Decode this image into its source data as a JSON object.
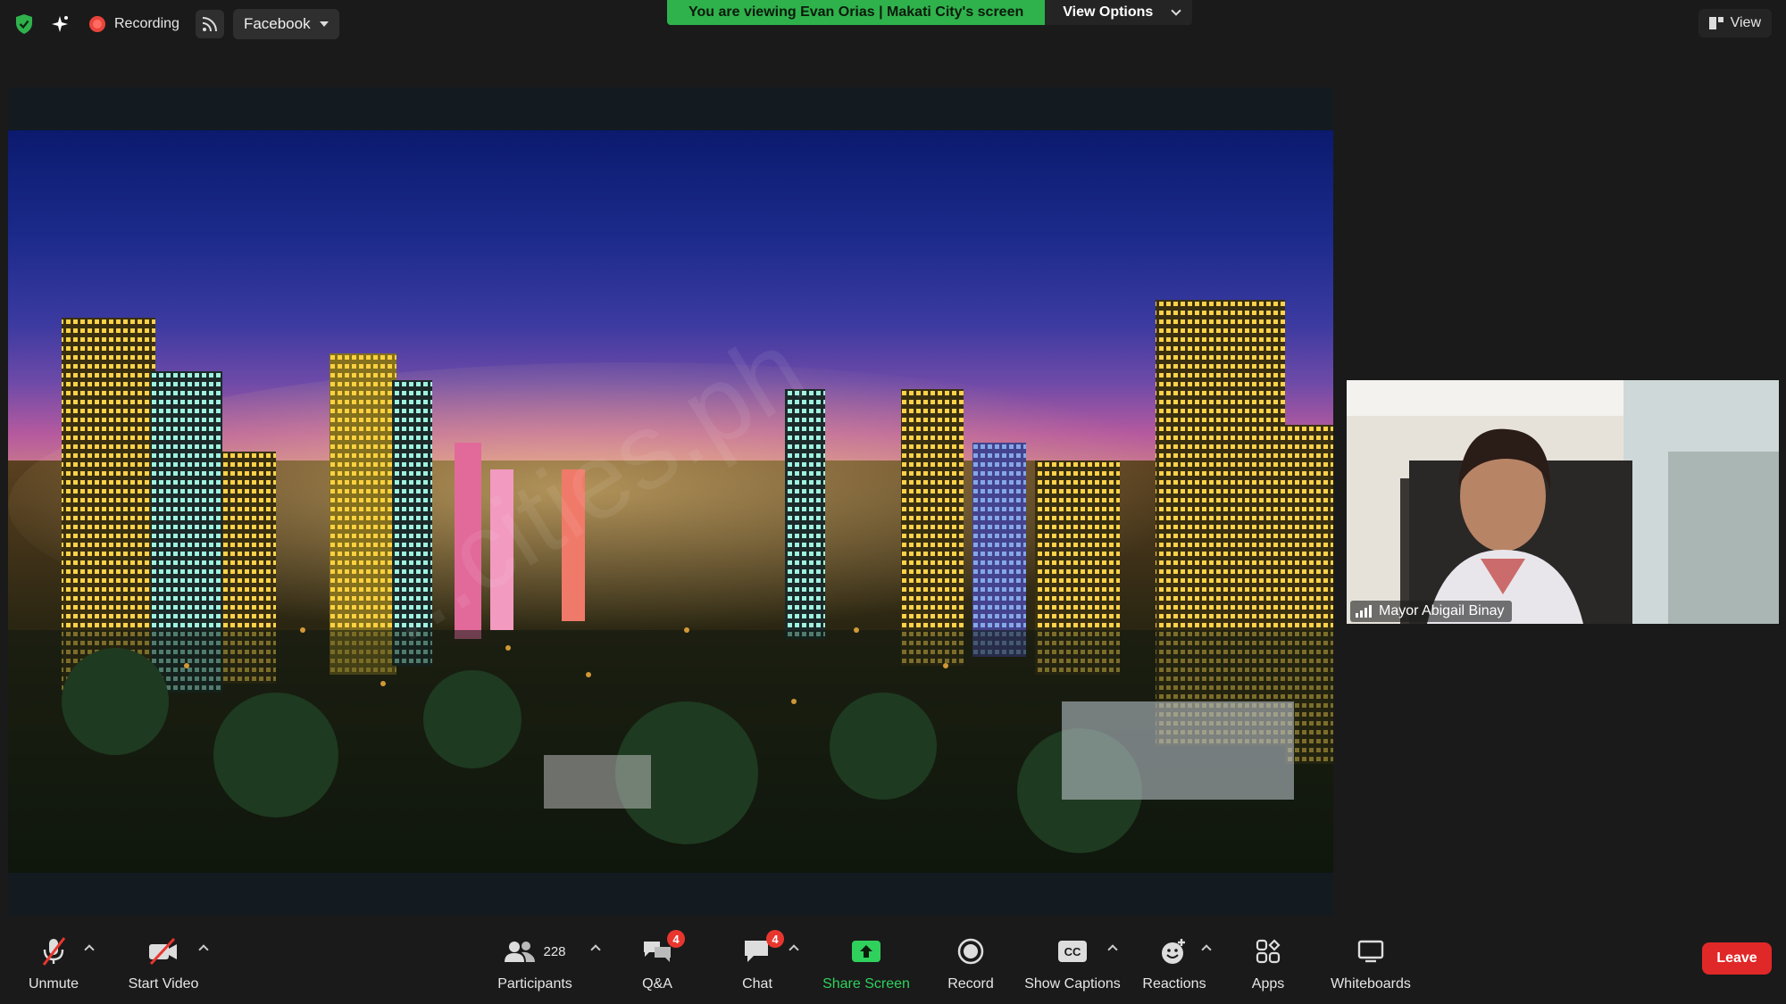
{
  "top_bar": {
    "recording_label": "Recording",
    "stream_target": "Facebook",
    "banner_text": "You are viewing Evan Orias | Makati City's screen",
    "view_options_label": "View Options",
    "view_label": "View"
  },
  "shared_screen": {
    "watermark": "...cities.ph"
  },
  "participant_tile": {
    "name": "Mayor Abigail Binay"
  },
  "toolbar": {
    "unmute": "Unmute",
    "start_video": "Start Video",
    "participants": "Participants",
    "participants_count": "228",
    "qa": "Q&A",
    "qa_badge": "4",
    "chat": "Chat",
    "chat_badge": "4",
    "share_screen": "Share Screen",
    "record": "Record",
    "show_captions": "Show Captions",
    "captions_icon_text": "CC",
    "reactions": "Reactions",
    "apps": "Apps",
    "whiteboards": "Whiteboards",
    "leave": "Leave"
  },
  "colors": {
    "banner_green": "#2fb24c",
    "share_screen_green": "#2fd15c",
    "leave_red": "#e02828",
    "badge_red": "#e8362e",
    "background": "#1a1a1a"
  }
}
